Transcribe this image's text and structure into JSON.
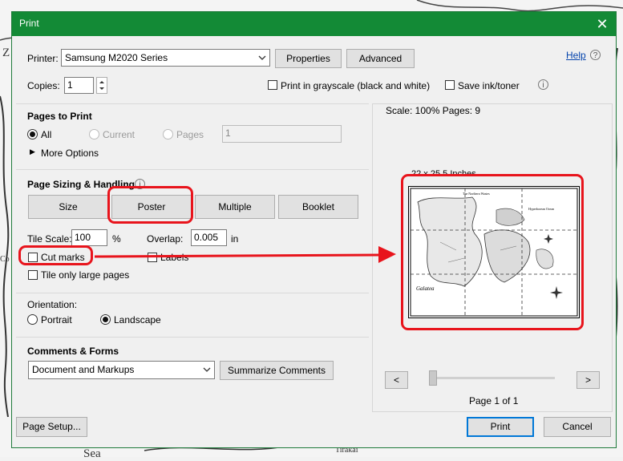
{
  "background": {
    "texts": [
      "Z",
      "Sea",
      "Tirakai",
      "Co"
    ],
    "map_labels": [
      "The Northern Wastes",
      "Galatea",
      "Hyperborean Ocean"
    ]
  },
  "dialog": {
    "title": "Print",
    "close_glyph": "✕",
    "printer_label": "Printer:",
    "printer_value": "Samsung M2020 Series",
    "properties_label": "Properties",
    "advanced_label": "Advanced",
    "help_label": "Help",
    "help_icon": "?",
    "copies_label": "Copies:",
    "copies_value": "1",
    "grayscale_label": "Print in grayscale (black and white)",
    "save_ink_label": "Save ink/toner",
    "info_glyph": "i",
    "pages_to_print": {
      "heading": "Pages to Print",
      "all_label": "All",
      "current_label": "Current",
      "pages_label": "Pages",
      "pages_value": "1",
      "more_options_label": "More Options"
    },
    "sizing": {
      "heading": "Page Sizing & Handling",
      "tabs": [
        "Size",
        "Poster",
        "Multiple",
        "Booklet"
      ],
      "tile_scale_label": "Tile Scale:",
      "tile_scale_value": "100",
      "percent": "%",
      "overlap_label": "Overlap:",
      "overlap_value": "0.005",
      "overlap_unit": "in",
      "cut_marks_label": "Cut marks",
      "labels_label": "Labels",
      "tile_large_label": "Tile only large pages"
    },
    "orientation": {
      "heading": "Orientation:",
      "portrait_label": "Portrait",
      "landscape_label": "Landscape"
    },
    "comments": {
      "heading": "Comments & Forms",
      "value": "Document and Markups",
      "summarize_label": "Summarize Comments"
    },
    "preview": {
      "scale_text": "Scale: 100% Pages: 9",
      "size_text": "22 x 25.5 Inches",
      "prev_glyph": "<",
      "next_glyph": ">",
      "page_text": "Page 1 of 1"
    },
    "page_setup_label": "Page Setup...",
    "print_label": "Print",
    "cancel_label": "Cancel"
  },
  "colors": {
    "titlebar": "#138a36",
    "highlight": "#e8141c",
    "accent": "#0078d7"
  }
}
